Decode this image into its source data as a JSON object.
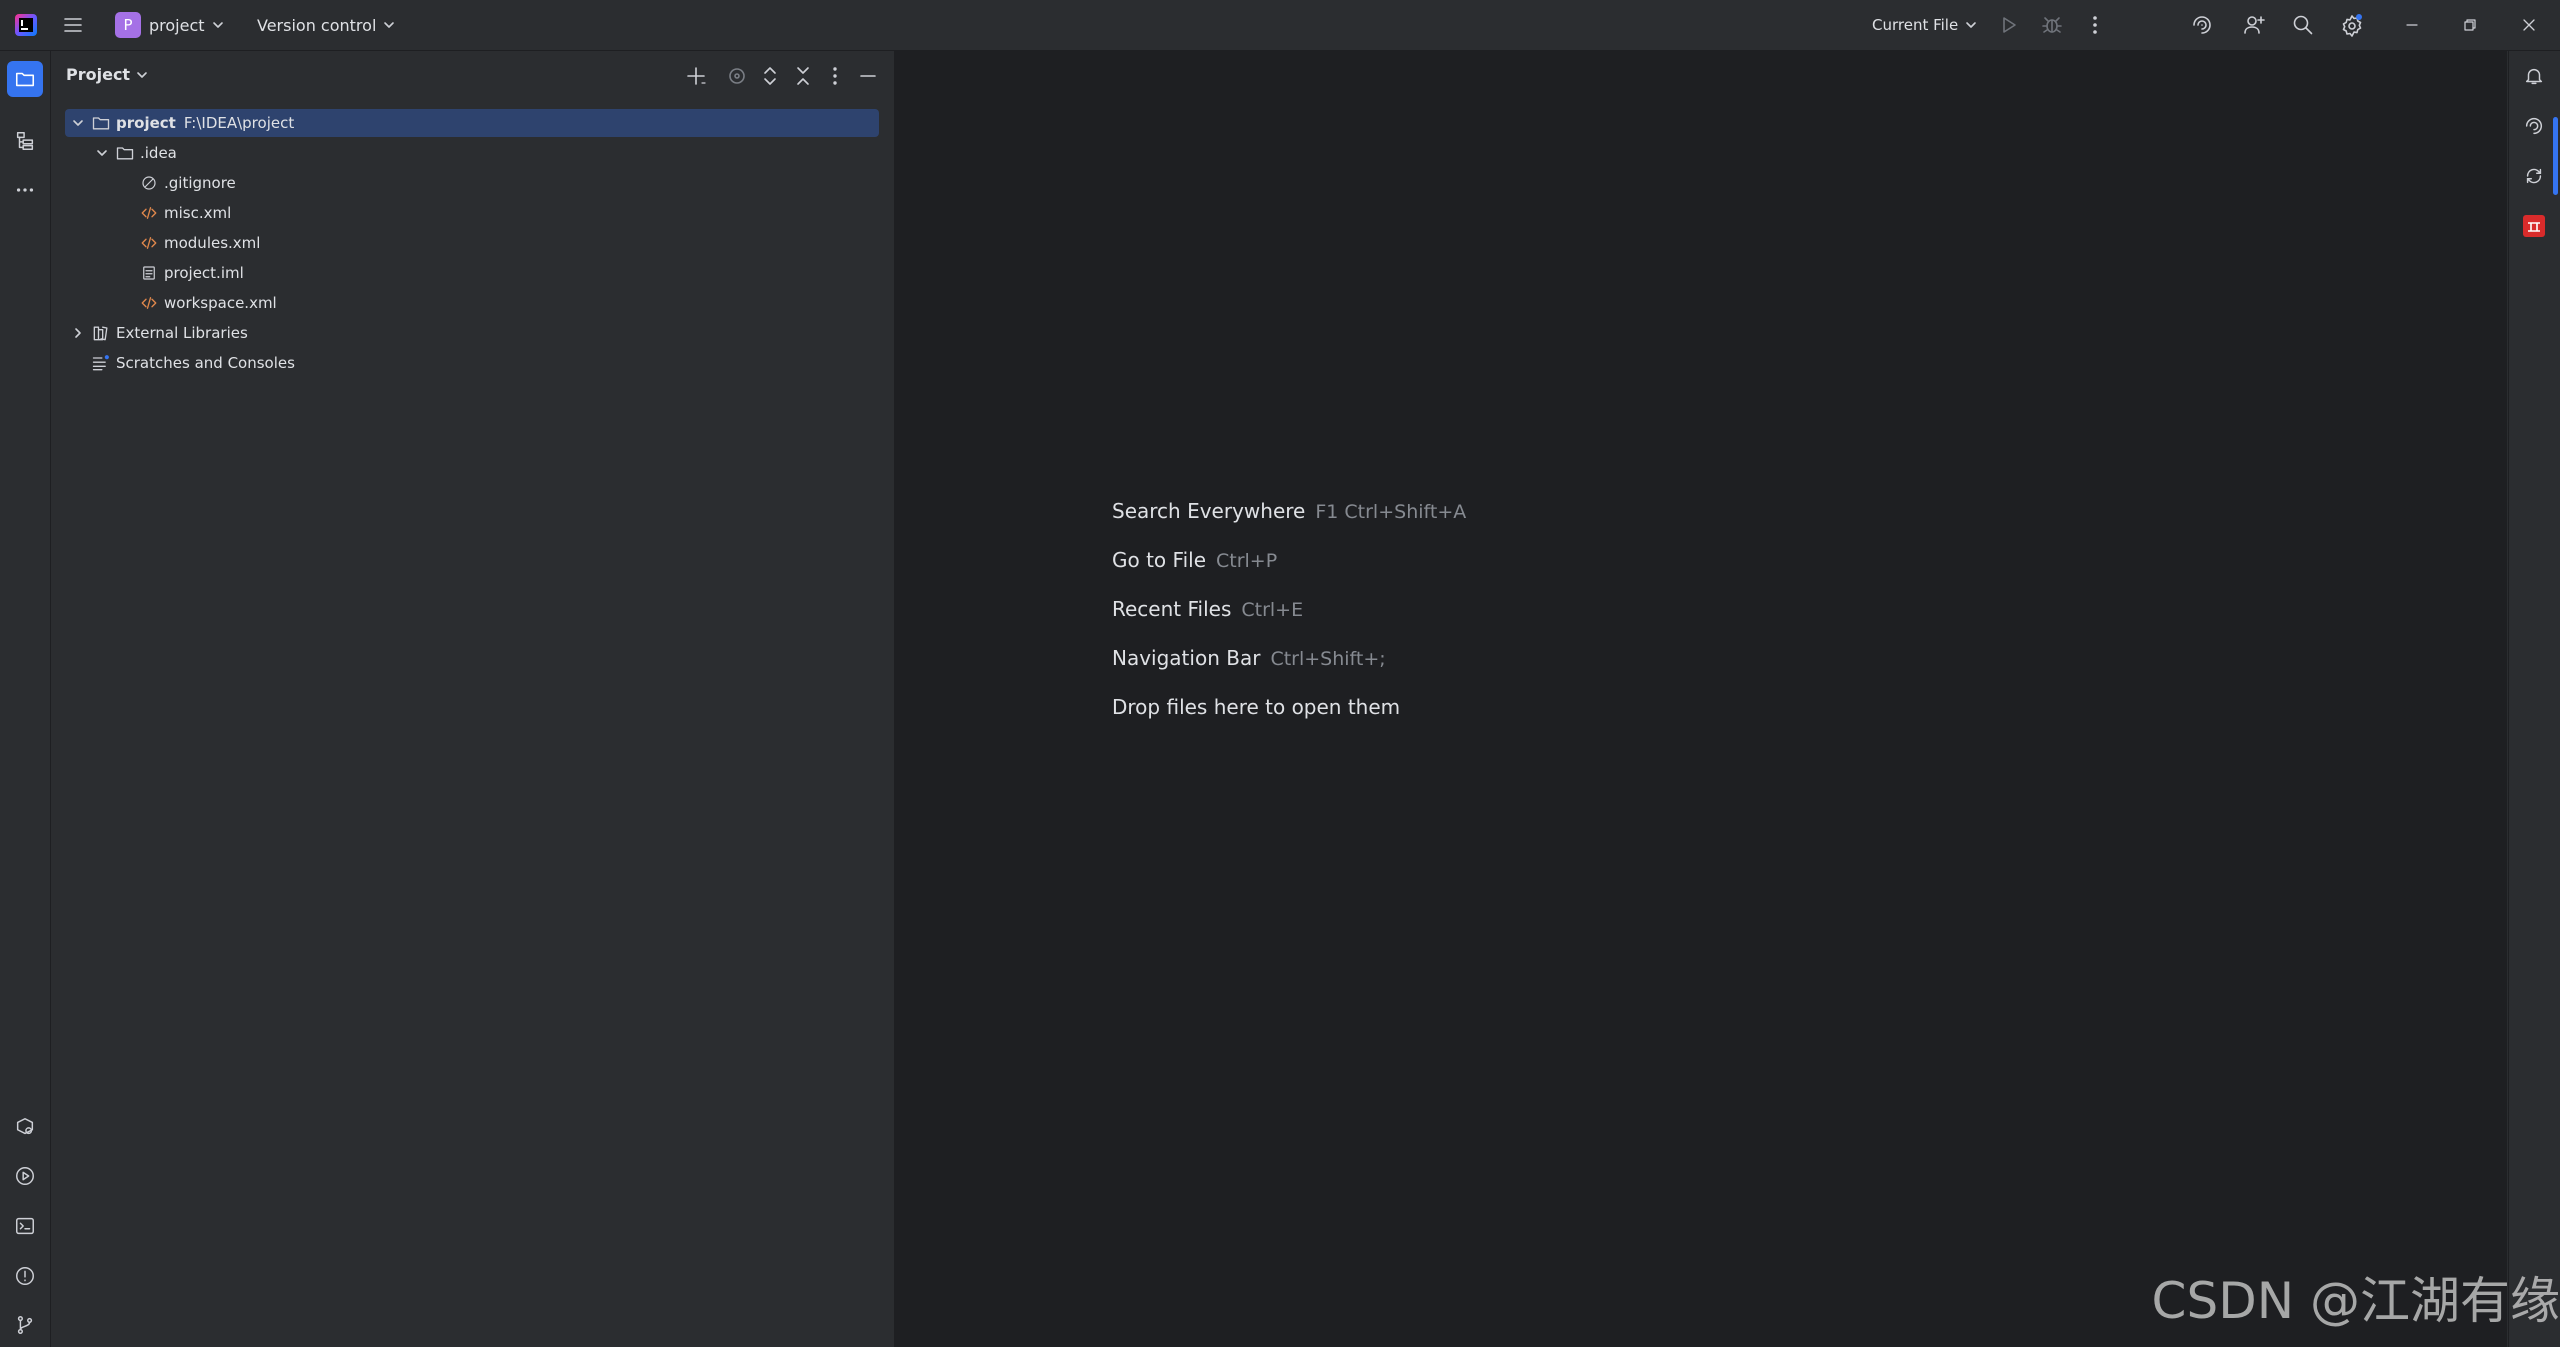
{
  "titlebar": {
    "project_badge": "P",
    "project_name": "project",
    "vcs_label": "Version control",
    "run_config": "Current File"
  },
  "panel": {
    "title": "Project"
  },
  "tree": [
    {
      "label": "project",
      "path": "F:\\IDEA\\project"
    },
    {
      "label": ".idea"
    },
    {
      "label": ".gitignore"
    },
    {
      "label": "misc.xml"
    },
    {
      "label": "modules.xml"
    },
    {
      "label": "project.iml"
    },
    {
      "label": "workspace.xml"
    },
    {
      "label": "External Libraries"
    },
    {
      "label": "Scratches and Consoles"
    }
  ],
  "editor": {
    "hints": [
      {
        "label": "Search Everywhere",
        "shortcut": "F1 Ctrl+Shift+A"
      },
      {
        "label": "Go to File",
        "shortcut": "Ctrl+P"
      },
      {
        "label": "Recent Files",
        "shortcut": "Ctrl+E"
      },
      {
        "label": "Navigation Bar",
        "shortcut": "Ctrl+Shift+;"
      },
      {
        "label": "Drop files here to open them",
        "shortcut": ""
      }
    ]
  },
  "watermark": "CSDN @江湖有缘",
  "colors": {
    "accent": "#3574f0",
    "selection": "#2e436e",
    "xml_icon": "#e0884c",
    "project_badge": "#a571e6"
  }
}
